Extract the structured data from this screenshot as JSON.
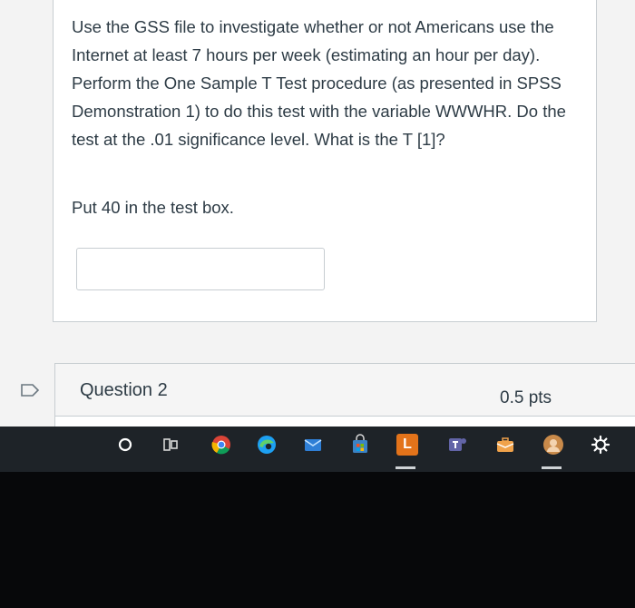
{
  "question": {
    "prompt": "Use the GSS file to investigate whether or not Americans use the Internet at least 7 hours per week (estimating an hour per day). Perform the One Sample T Test procedure (as presented in SPSS Demonstration 1) to do this test with the variable WWWHR. Do the test at the .01 significance level. What is the T [1]?",
    "note": "Put 40 in the test box.",
    "answer_value": ""
  },
  "next_question": {
    "title": "Question 2",
    "points": "0.5 pts"
  },
  "taskbar": {
    "icons": [
      "start-icon",
      "task-view-icon",
      "chrome-icon",
      "edge-icon",
      "mail-icon",
      "store-icon",
      "app-l-icon",
      "teams-icon",
      "briefcase-icon",
      "avatar-icon",
      "settings-icon"
    ],
    "app_l_label": "L"
  },
  "colors": {
    "text": "#2d3b45",
    "border": "#c7cdd1",
    "taskbar": "#1e2328"
  }
}
